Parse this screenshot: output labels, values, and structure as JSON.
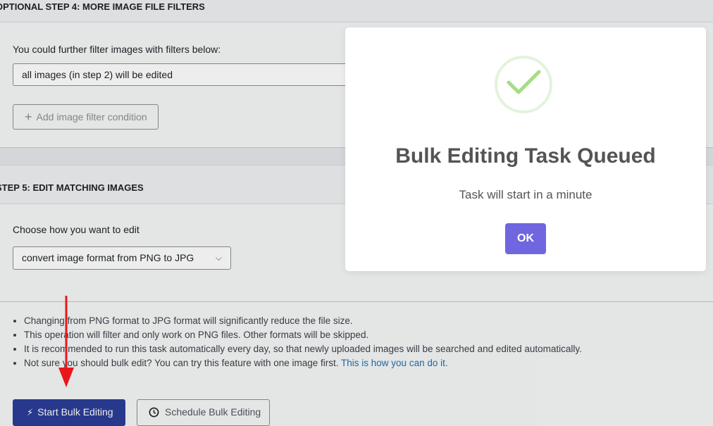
{
  "step4": {
    "header": "OPTIONAL STEP 4: MORE IMAGE FILE FILTERS",
    "filter_label": "You could further filter images with filters below:",
    "filter_select_value": "all images (in step 2) will be edited",
    "add_filter_label": "Add image filter condition"
  },
  "step5": {
    "header": "STEP 5: EDIT MATCHING IMAGES",
    "edit_label": "Choose how you want to edit",
    "edit_select_value": "convert image format from PNG to JPG"
  },
  "tips": [
    "Changing from PNG format to JPG format will significantly reduce the file size.",
    "This operation will filter and only work on PNG files. Other formats will be skipped.",
    "It is recommended to run this task automatically every day, so that newly uploaded images will be searched and edited automatically.",
    "Not sure you should bulk edit? You can try this feature with one image first."
  ],
  "tip_link": "This is how you can do it.",
  "buttons": {
    "start": "Start Bulk Editing",
    "schedule": "Schedule Bulk Editing"
  },
  "modal": {
    "title": "Bulk Editing Task Queued",
    "text": "Task will start in a minute",
    "ok": "OK"
  },
  "icons": {
    "chevron": "chevron-down-icon",
    "plus": "plus-icon",
    "bolt": "lightning-icon",
    "clock": "clock-icon",
    "success": "checkmark-icon",
    "arrow": "red-arrow-icon"
  },
  "colors": {
    "primary_button": "#2c3e98",
    "modal_ok": "#7066e0",
    "success": "#a5dc86",
    "annotation_arrow": "#e8171c",
    "link": "#2271b1"
  }
}
